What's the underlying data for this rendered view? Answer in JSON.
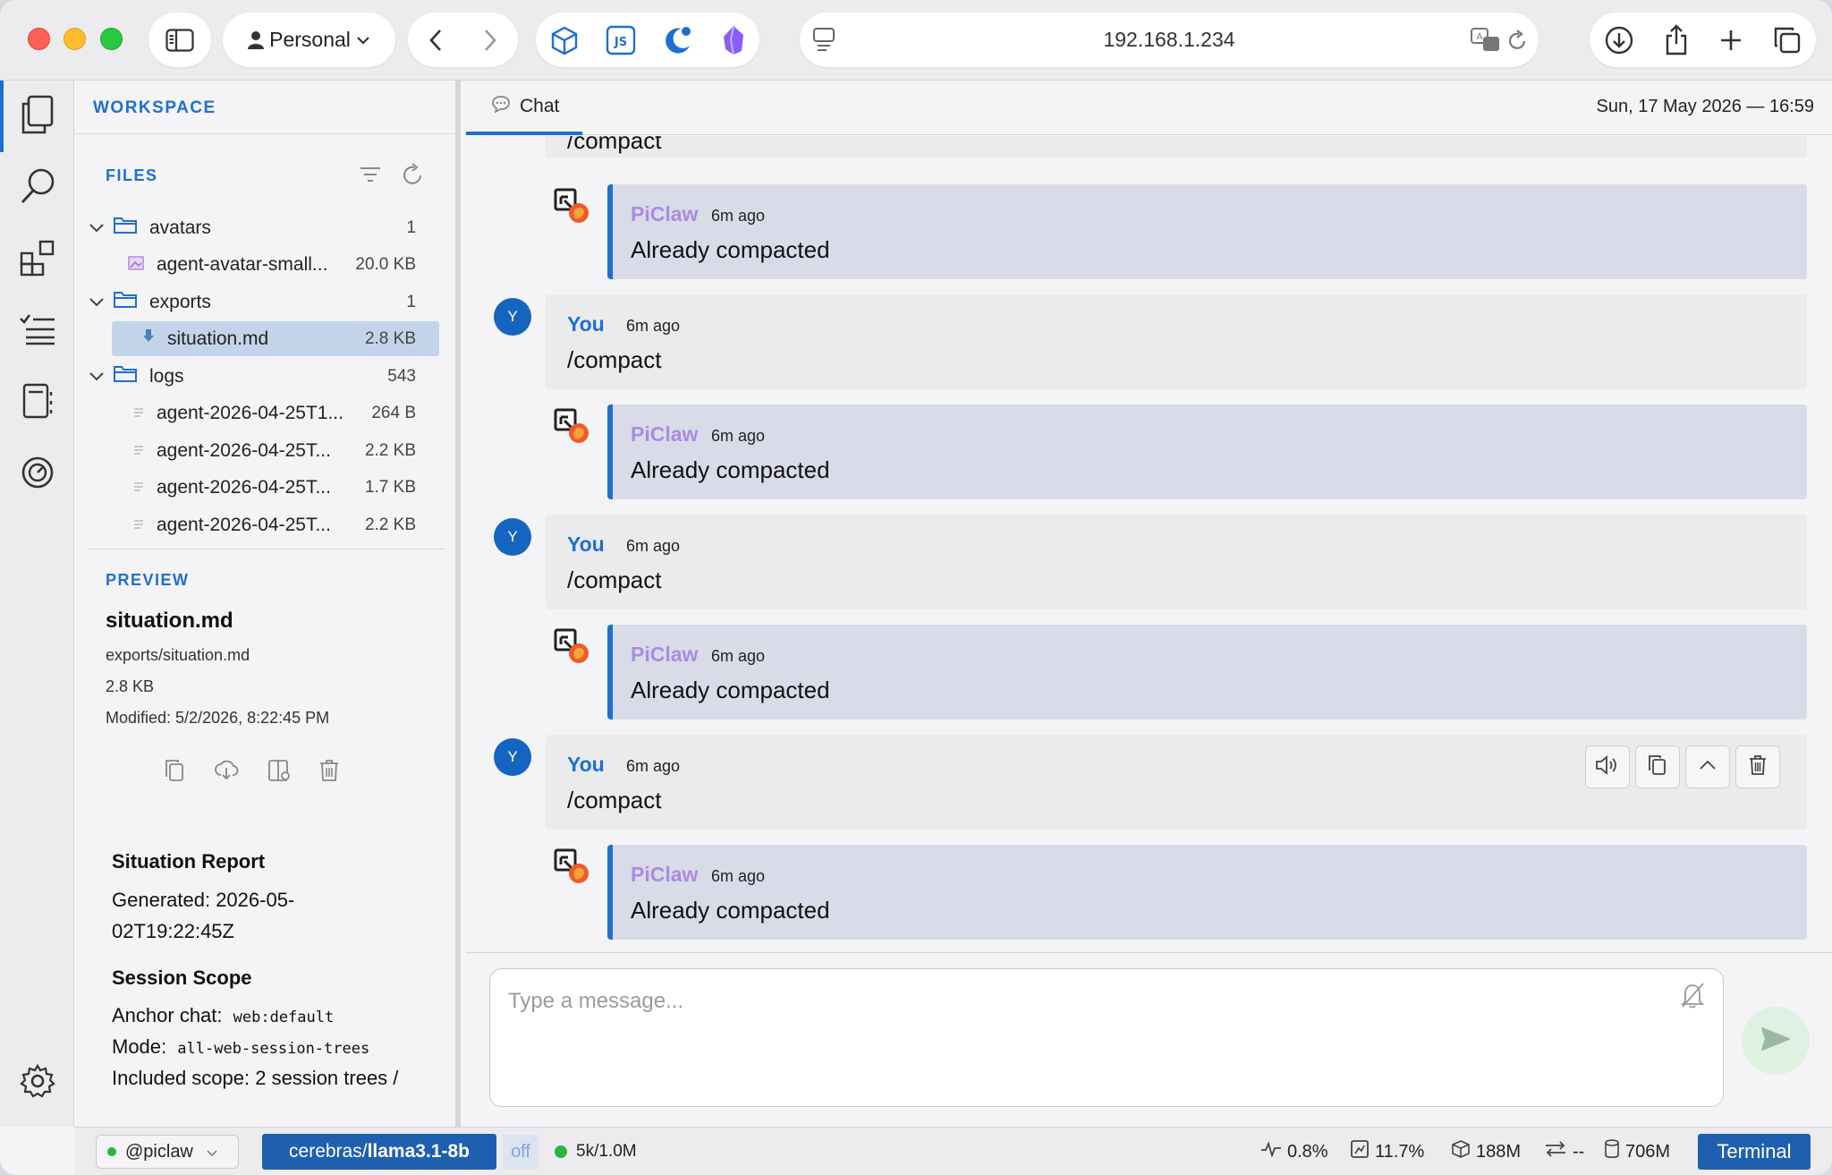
{
  "toolbar": {
    "profile": "Personal",
    "url": "192.168.1.234",
    "extension_js_label": "JS"
  },
  "activity_bar": {
    "items": [
      "files-icon",
      "search-icon",
      "extensions-icon",
      "tasks-icon",
      "notebook-icon",
      "dashboard-icon",
      "settings-icon"
    ]
  },
  "sidebar": {
    "workspace_label": "WORKSPACE",
    "files_label": "FILES",
    "tree": [
      {
        "name": "avatars",
        "type": "folder",
        "meta": "1"
      },
      {
        "name": "agent-avatar-small...",
        "type": "image",
        "meta": "20.0 KB"
      },
      {
        "name": "exports",
        "type": "folder",
        "meta": "1"
      },
      {
        "name": "situation.md",
        "type": "markdown",
        "meta": "2.8 KB"
      },
      {
        "name": "logs",
        "type": "folder",
        "meta": "543"
      },
      {
        "name": "agent-2026-04-25T1...",
        "type": "text",
        "meta": "264 B"
      },
      {
        "name": "agent-2026-04-25T...",
        "type": "text",
        "meta": "2.2 KB"
      },
      {
        "name": "agent-2026-04-25T...",
        "type": "text",
        "meta": "1.7 KB"
      },
      {
        "name": "agent-2026-04-25T...",
        "type": "text",
        "meta": "2.2 KB"
      }
    ],
    "preview_label": "PREVIEW",
    "preview": {
      "title": "situation.md",
      "path": "exports/situation.md",
      "size": "2.8 KB",
      "modified": "Modified: 5/2/2026, 8:22:45 PM"
    },
    "doc": {
      "h1": "Situation Report",
      "generated_line1": "Generated: 2026-05-",
      "generated_line2": "02T19:22:45Z",
      "h2": "Session Scope",
      "anchor_label": "Anchor chat:",
      "anchor_value": "web:default",
      "mode_label": "Mode:",
      "mode_value": "all-web-session-trees",
      "included": "Included scope: 2 session trees /"
    }
  },
  "chat": {
    "tab_label": "Chat",
    "datetime": "Sun, 17 May 2026 — 16:59",
    "partial_top": "/compact",
    "messages": [
      {
        "author": "PiClaw",
        "ago": "6m ago",
        "text": "Already compacted",
        "role": "bot"
      },
      {
        "author": "You",
        "ago": "6m ago",
        "text": "/compact",
        "role": "user",
        "avatar": "Y"
      },
      {
        "author": "PiClaw",
        "ago": "6m ago",
        "text": "Already compacted",
        "role": "bot"
      },
      {
        "author": "You",
        "ago": "6m ago",
        "text": "/compact",
        "role": "user",
        "avatar": "Y"
      },
      {
        "author": "PiClaw",
        "ago": "6m ago",
        "text": "Already compacted",
        "role": "bot"
      },
      {
        "author": "You",
        "ago": "6m ago",
        "text": "/compact",
        "role": "user",
        "avatar": "Y"
      },
      {
        "author": "PiClaw",
        "ago": "6m ago",
        "text": "Already compacted",
        "role": "bot"
      }
    ],
    "composer_placeholder": "Type a message..."
  },
  "statusbar": {
    "agent": "@piclaw",
    "model_prefix": "cerebras/",
    "model_name": "llama3.1-8b",
    "thinking": "off",
    "context": "5k/1.0M",
    "cpu": "0.8%",
    "mem_pct": "11.7%",
    "mem": "188M",
    "net": "--",
    "disk": "706M",
    "terminal": "Terminal"
  },
  "colors": {
    "accent": "#1f6fd0",
    "bot_name": "#a98ce0",
    "status_green": "#28b446"
  }
}
